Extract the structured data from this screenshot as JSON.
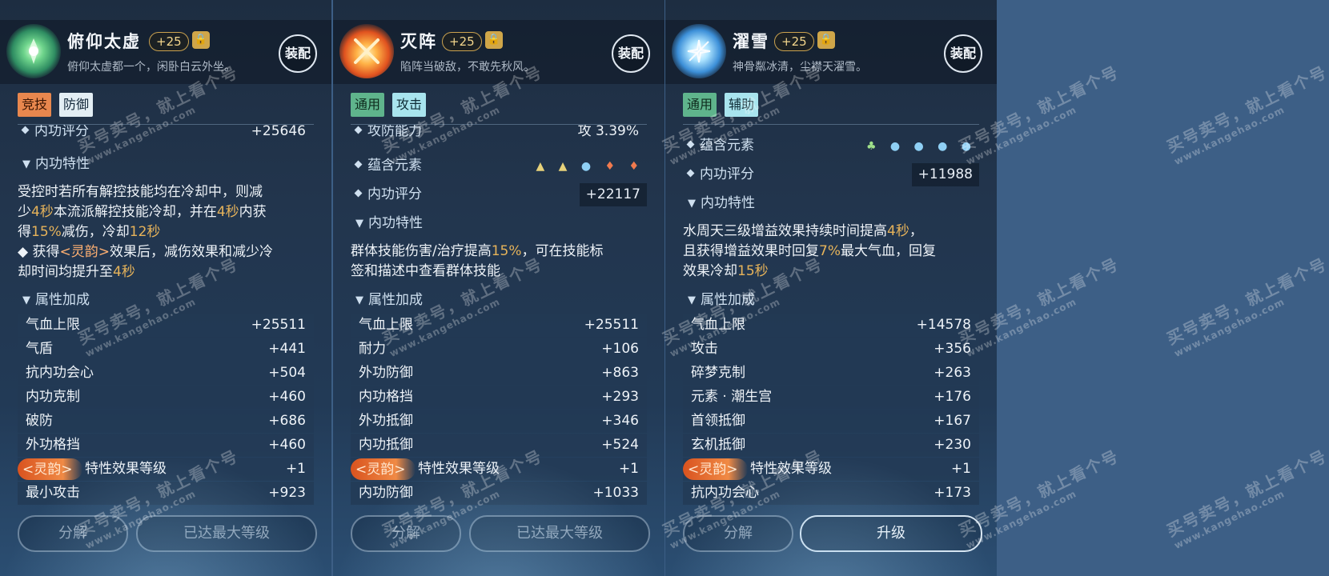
{
  "panels": [
    {
      "title": "俯仰太虚",
      "level_bonus": "+25",
      "subtitle": "俯仰太虚都一个，闲卧白云外坐。",
      "equip_label": "装配",
      "tags": [
        "竞技",
        "防御"
      ],
      "partial_row": {
        "label": "内功评分",
        "value": "+25646"
      },
      "trait_heading": "内功特性",
      "trait_lines": [
        "受控时若所有解控技能均在冷却中，则减",
        "少4秒本流派解控技能冷却，并在4秒内获",
        "得15%减伤，冷却12秒",
        "◆ 获得<灵韵>效果后，减伤效果和减少冷",
        "却时间均提升至4秒"
      ],
      "attr_heading": "属性加成",
      "attrs": [
        {
          "label": "气血上限",
          "value": "+25511"
        },
        {
          "label": "气盾",
          "value": "+441"
        },
        {
          "label": "抗内功会心",
          "value": "+504"
        },
        {
          "label": "内功克制",
          "value": "+460"
        },
        {
          "label": "破防",
          "value": "+686"
        },
        {
          "label": "外功格挡",
          "value": "+460"
        }
      ],
      "special": {
        "pill": "<灵韵>",
        "label": "特性效果等级",
        "value": "+1"
      },
      "last_row": {
        "label": "最小攻击",
        "value": "+923"
      },
      "btn_left": "分解",
      "btn_right": "已达最大等级"
    },
    {
      "title": "灭阵",
      "level_bonus": "+25",
      "subtitle": "陷阵当破敌，不敢先秋风。",
      "equip_label": "装配",
      "tags": [
        "通用",
        "攻击"
      ],
      "partial_row": {
        "label": "攻防能力",
        "value": "攻 3.39%"
      },
      "element_label": "蕴含元素",
      "element_icons": [
        "▲",
        "▲",
        "●",
        "♦",
        "♦"
      ],
      "score_label": "内功评分",
      "score_value": "+22117",
      "trait_heading": "内功特性",
      "trait_lines": [
        "群体技能伤害/治疗提高15%，可在技能标",
        "签和描述中查看群体技能"
      ],
      "attr_heading": "属性加成",
      "attrs": [
        {
          "label": "气血上限",
          "value": "+25511"
        },
        {
          "label": "耐力",
          "value": "+106"
        },
        {
          "label": "外功防御",
          "value": "+863"
        },
        {
          "label": "内功格挡",
          "value": "+293"
        },
        {
          "label": "外功抵御",
          "value": "+346"
        },
        {
          "label": "内功抵御",
          "value": "+524"
        }
      ],
      "special": {
        "pill": "<灵韵>",
        "label": "特性效果等级",
        "value": "+1"
      },
      "last_row": {
        "label": "内功防御",
        "value": "+1033"
      },
      "btn_left": "分解",
      "btn_right": "已达最大等级"
    },
    {
      "title": "濯雪",
      "level_bonus": "+25",
      "subtitle": "神骨粼冰清，尘襟天濯雪。",
      "equip_label": "装配",
      "tags": [
        "通用",
        "辅助"
      ],
      "element_label": "蕴含元素",
      "element_icons": [
        "♣",
        "●",
        "●",
        "●",
        "●"
      ],
      "score_label": "内功评分",
      "score_value": "+11988",
      "trait_heading": "内功特性",
      "trait_lines": [
        "水周天三级增益效果持续时间提高4秒，",
        "且获得增益效果时回复7%最大气血，回复",
        "效果冷却15秒"
      ],
      "attr_heading": "属性加成",
      "attrs": [
        {
          "label": "气血上限",
          "value": "+14578"
        },
        {
          "label": "攻击",
          "value": "+356"
        },
        {
          "label": "碎梦克制",
          "value": "+263"
        },
        {
          "label": "元素 · 潮生宫",
          "value": "+176"
        },
        {
          "label": "首领抵御",
          "value": "+167"
        },
        {
          "label": "玄机抵御",
          "value": "+230"
        }
      ],
      "special": {
        "pill": "<灵韵>",
        "label": "特性效果等级",
        "value": "+1"
      },
      "last_row": {
        "label": "抗内功会心",
        "value": "+173"
      },
      "btn_left": "分解",
      "btn_right": "升级"
    }
  ],
  "watermark": {
    "line1": "买号卖号，就上看个号",
    "line2": "www.kangehao.com"
  }
}
